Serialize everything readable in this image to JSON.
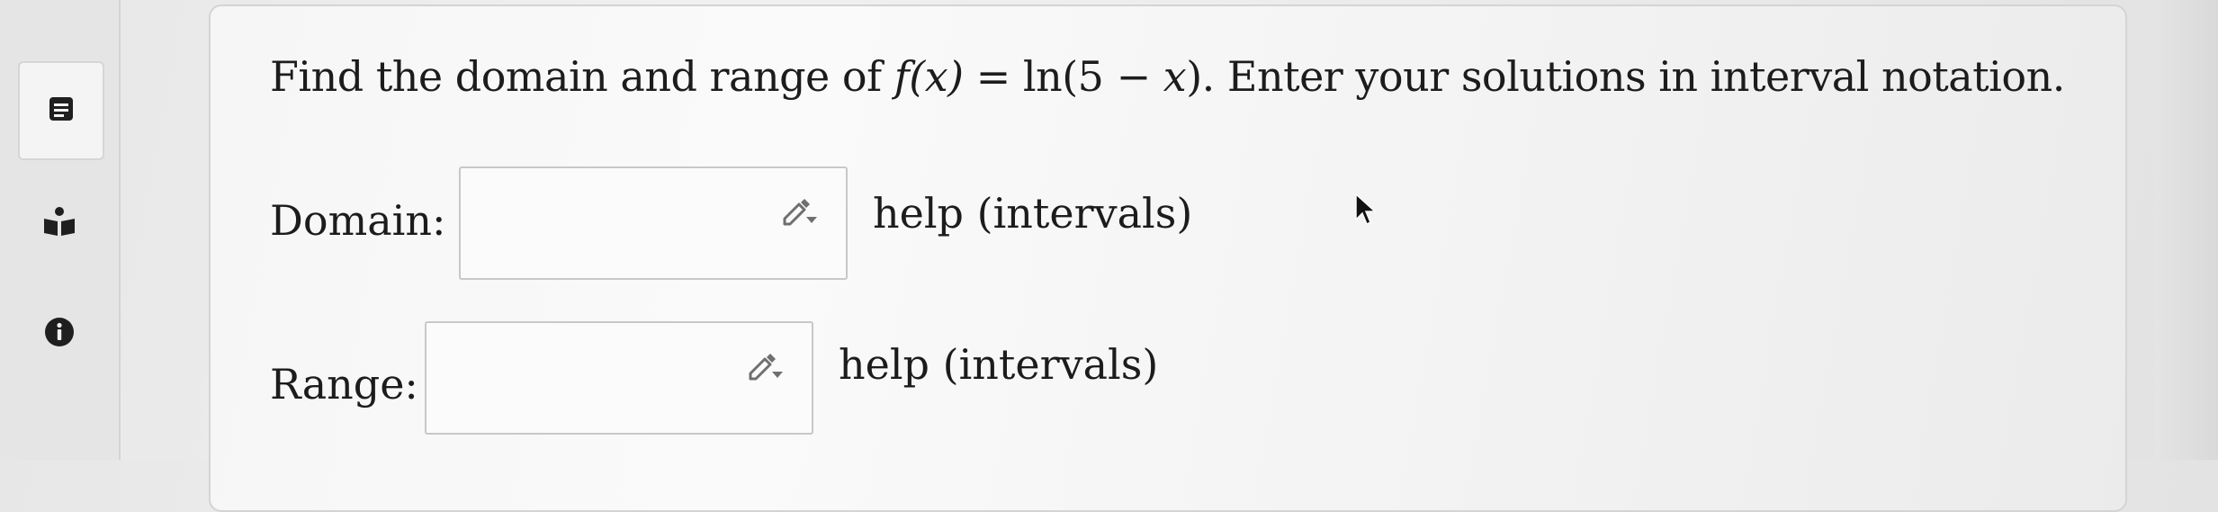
{
  "sidebar": {
    "items": [
      {
        "icon": "notes-icon"
      },
      {
        "icon": "reader-icon"
      },
      {
        "icon": "info-icon"
      }
    ]
  },
  "question": {
    "prefix": "Find the domain and range of ",
    "function_lhs": "f(x)",
    "equals": " = ",
    "function_rhs_ln": "ln(5 − ",
    "function_rhs_x": "x",
    "function_rhs_close": ")",
    "suffix": ". Enter your solutions in interval notation."
  },
  "domain": {
    "label": "Domain:",
    "value": "",
    "help_text": "help (intervals)"
  },
  "range": {
    "label": "Range:",
    "value": "",
    "help_text": "help (intervals)"
  },
  "colors": {
    "text": "#1c1c1c",
    "icon": "#1f1f1f",
    "box_border": "#c8c8c8"
  }
}
